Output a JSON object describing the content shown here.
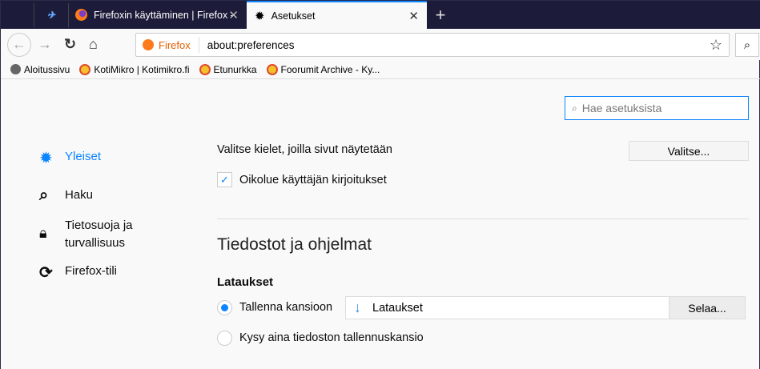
{
  "tabs": [
    {
      "title": "Firefoxin käyttäminen | Firefox -",
      "active": false
    },
    {
      "title": "Asetukset",
      "active": true
    }
  ],
  "new_tab": "+",
  "urlbar": {
    "identity": "Firefox",
    "url": "about:preferences"
  },
  "bookmarks": [
    "Aloitussivu",
    "KotiMikro | Kotimikro.fi",
    "Etunurkka",
    "Foorumit Archive - Ky..."
  ],
  "search": {
    "placeholder": "Hae asetuksista"
  },
  "sidebar": [
    {
      "label": "Yleiset",
      "selected": true
    },
    {
      "label": "Haku"
    },
    {
      "label": "Tietosuoja ja turvallisuus",
      "line1": "Tietosuoja ja",
      "line2": "turvallisuus"
    },
    {
      "label": "Firefox-tili"
    }
  ],
  "main": {
    "languages_label": "Valitse kielet, joilla sivut näytetään",
    "choose_button": "Valitse...",
    "spellcheck_label": "Oikolue käyttäjän kirjoitukset",
    "spellcheck_checked": true,
    "section_title": "Tiedostot ja ohjelmat",
    "downloads_title": "Lataukset",
    "save_to_label": "Tallenna kansioon",
    "folder": "Lataukset",
    "browse_button": "Selaa...",
    "ask_label": "Kysy aina tiedoston tallennuskansio"
  },
  "colors": {
    "accent": "#0a84ff",
    "tabbar": "#1c1b3a"
  }
}
